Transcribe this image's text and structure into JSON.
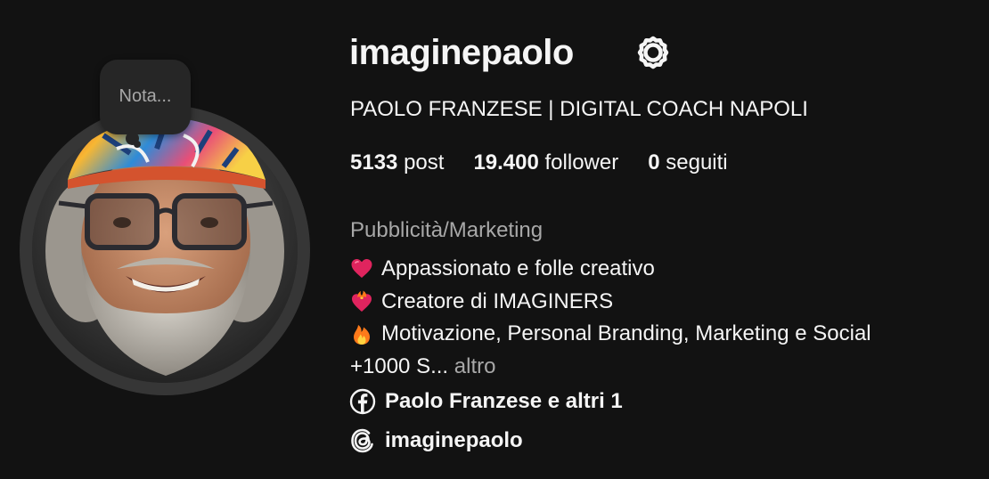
{
  "note": {
    "text": "Nota..."
  },
  "profile": {
    "username": "imaginepaolo",
    "full_name": "PAOLO FRANZESE | DIGITAL COACH NAPOLI",
    "category": "Pubblicità/Marketing"
  },
  "stats": {
    "posts_count": "5133",
    "posts_label": "post",
    "followers_count": "19.400",
    "followers_label": "follower",
    "following_count": "0",
    "following_label": "seguiti"
  },
  "bio": {
    "lines": [
      {
        "emoji": "red-heart",
        "text": "Appassionato e folle creativo"
      },
      {
        "emoji": "heart-on-fire",
        "text": "Creatore di IMAGINERS"
      },
      {
        "emoji": "fire",
        "text": "Motivazione, Personal Branding, Marketing e Social"
      },
      {
        "emoji": "",
        "text": "+1000 S..."
      }
    ],
    "more_label": "altro"
  },
  "links": {
    "facebook": {
      "icon": "facebook-icon",
      "label": "Paolo Franzese e altri 1"
    },
    "threads": {
      "icon": "threads-icon",
      "label": "imaginepaolo"
    }
  },
  "colors": {
    "background": "#121212",
    "primary_text": "#f5f5f5",
    "secondary_text": "#a8a8a8",
    "bubble": "#262626",
    "heart_red": "#e0245e",
    "fire_orange": "#ff7a1a"
  }
}
